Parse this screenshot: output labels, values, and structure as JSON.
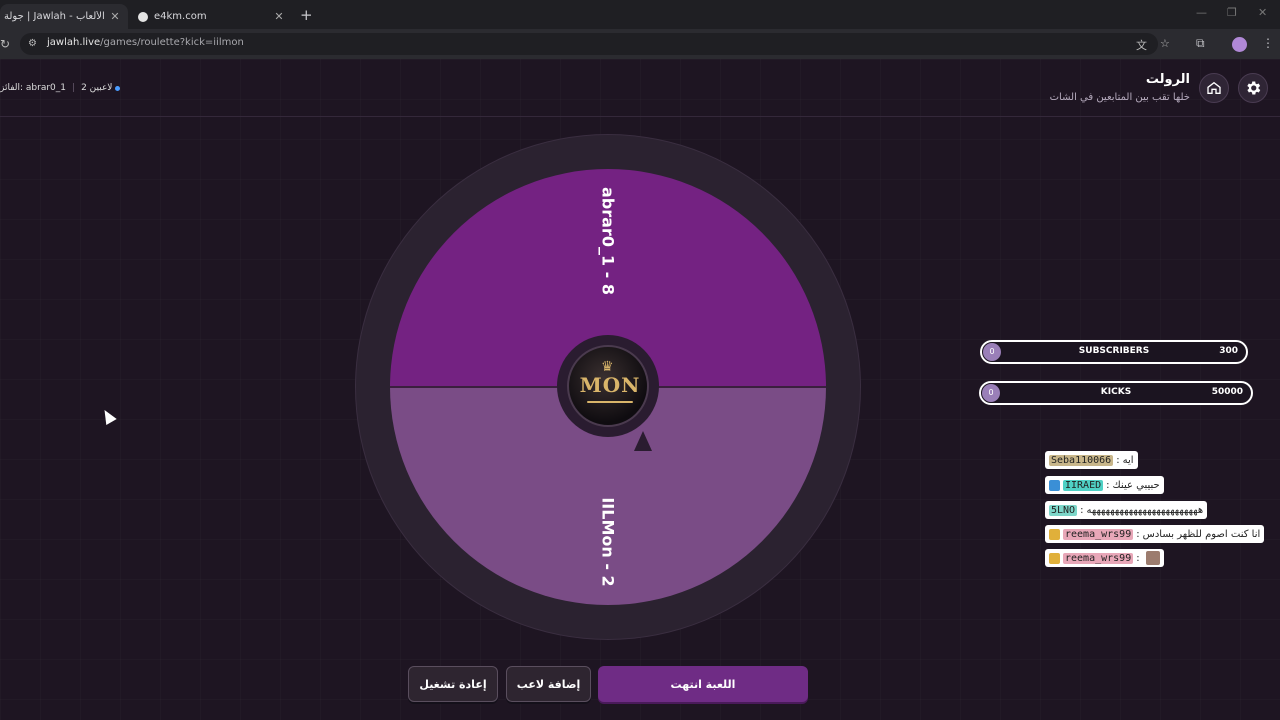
{
  "browser": {
    "tabs": [
      {
        "title": "جولة | Jawlah - منصة الألعاب",
        "close": "✕",
        "active": true
      },
      {
        "title": "e4km.com",
        "close": "✕",
        "active": false
      }
    ],
    "new_tab": "+",
    "url_host": "jawlah.live",
    "url_path": "/games/roulette?kick=iilmon"
  },
  "header": {
    "title": "الرولت",
    "subtitle": "خلها تقب بين المتابعين في الشات",
    "status_winner": "الفائز: abrar0_1",
    "status_players": "2 لاعبين"
  },
  "wheel": {
    "segments": [
      {
        "label": "abrar0_1 - 8",
        "color": "#742282"
      },
      {
        "label": "IILMon - 2",
        "color": "#7a4c86"
      }
    ],
    "logo_text": "MON"
  },
  "goals": [
    {
      "count": "0",
      "name": "SUBSCRIBERS",
      "target": "300"
    },
    {
      "count": "0",
      "name": "KICKS",
      "target": "50000"
    }
  ],
  "chat": [
    {
      "user": "Seba110066",
      "sep": ":",
      "message": "ايه",
      "user_bg": "#c8b68a",
      "badge": ""
    },
    {
      "user": "IIRAED",
      "sep": ":",
      "message": "حبيبي عينك",
      "user_bg": "#4fd1c5",
      "badge": "#3a8fd6"
    },
    {
      "user": "5LNO",
      "sep": ":",
      "message": "ههههههههههههههههههههههههه",
      "user_bg": "#7dd6c9",
      "badge": ""
    },
    {
      "user": "reema_wrs99",
      "sep": ":",
      "message": "انا كنت اصوم للظهر بسادس",
      "user_bg": "#e8a7b8",
      "badge": "#e0b03a"
    },
    {
      "user": "reema_wrs99",
      "sep": ":",
      "message": "",
      "user_bg": "#e8a7b8",
      "badge": "#e0b03a"
    }
  ],
  "buttons": {
    "game_over": "اللعبة انتهت",
    "add_player": "إضافة لاعب",
    "restart": "إعادة تشغيل"
  },
  "colors": {
    "accent": "#6f2c85",
    "background": "#1e1522"
  },
  "icons": [
    "gear-icon",
    "home-icon",
    "reload-icon",
    "translate-icon",
    "star-icon",
    "extensions-icon",
    "menu-icon"
  ]
}
